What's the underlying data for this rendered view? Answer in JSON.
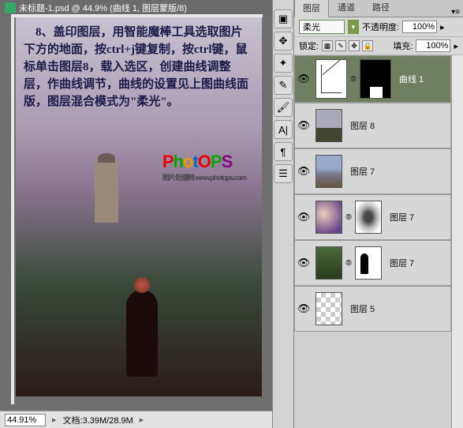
{
  "document": {
    "title": "未标题-1.psd @ 44.9% (曲线 1, 图层蒙版/8)",
    "tutorial_text": "　8、盖印图层，用智能魔棒工具选取图片下方的地面，按ctrl+j键复制，按ctrl键，鼠标单击图层8，载入选区，创建曲线调整层，作曲线调节，曲线的设置见上图曲线面版，图层混合模式为\"柔光\"。",
    "watermark": "PhotOPS",
    "watermark_sub": "照片处理网  www.photops.com"
  },
  "status": {
    "zoom": "44.91%",
    "doc_size": "文档:3.39M/28.9M"
  },
  "panel": {
    "tabs": {
      "layers": "图层",
      "channels": "通道",
      "paths": "路径"
    },
    "blend_mode": "柔光",
    "opacity_label": "不透明度:",
    "opacity_value": "100%",
    "lock_label": "锁定:",
    "fill_label": "填充:",
    "fill_value": "100%"
  },
  "layers": [
    {
      "name": "曲线 1",
      "type": "adjustment",
      "selected": true
    },
    {
      "name": "图层 8",
      "type": "image"
    },
    {
      "name": "图层 7",
      "type": "image"
    },
    {
      "name": "图层 7",
      "type": "image_masked"
    },
    {
      "name": "图层 7",
      "type": "image_masked2"
    },
    {
      "name": "图层 5",
      "type": "image"
    }
  ]
}
